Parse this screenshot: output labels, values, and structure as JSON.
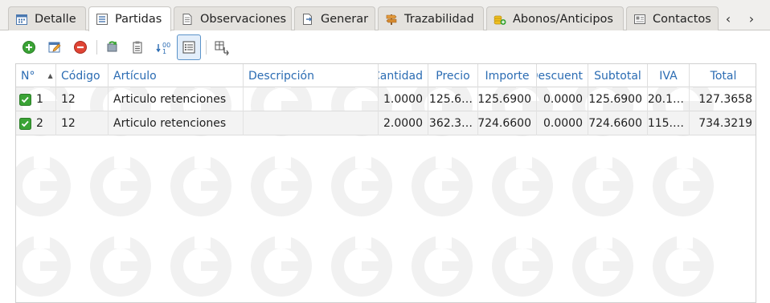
{
  "tabs": [
    {
      "label": "Detalle",
      "icon": "calendar-icon",
      "active": false
    },
    {
      "label": "Partidas",
      "icon": "list-icon",
      "active": true
    },
    {
      "label": "Observaciones",
      "icon": "document-icon",
      "active": false
    },
    {
      "label": "Generar",
      "icon": "document-arrow-icon",
      "active": false
    },
    {
      "label": "Trazabilidad",
      "icon": "signpost-icon",
      "active": false
    },
    {
      "label": "Abonos/Anticipos",
      "icon": "coins-add-icon",
      "active": false
    },
    {
      "label": "Contactos",
      "icon": "contacts-card-icon",
      "active": false
    }
  ],
  "nav": {
    "prev": "‹",
    "next": "›"
  },
  "toolbar": {
    "buttons": [
      "add-icon",
      "edit-icon",
      "remove-icon",
      "refresh-icon",
      "clipboard-icon",
      "numbering-icon",
      "list-settings-icon",
      "columns-icon"
    ]
  },
  "grid": {
    "columns": [
      {
        "label": "N°",
        "sort": "ascending"
      },
      {
        "label": "Código"
      },
      {
        "label": "Artículo"
      },
      {
        "label": "Descripción"
      },
      {
        "label": "Cantidad"
      },
      {
        "label": "Precio"
      },
      {
        "label": "Importe"
      },
      {
        "label": "Descuent"
      },
      {
        "label": "Subtotal"
      },
      {
        "label": "IVA"
      },
      {
        "label": "Total"
      }
    ],
    "sort_arrow": "▲",
    "rows": [
      {
        "checked": true,
        "n": "1",
        "codigo": "12",
        "articulo": "Articulo retenciones",
        "descripcion": "",
        "cantidad": "1.0000",
        "precio": "125.6…",
        "importe": "125.6900",
        "descuento": "0.0000",
        "subtotal": "125.6900",
        "iva": "20.1…",
        "total": "127.3658"
      },
      {
        "checked": true,
        "n": "2",
        "codigo": "12",
        "articulo": "Articulo retenciones",
        "descripcion": "",
        "cantidad": "2.0000",
        "precio": "362.3…",
        "importe": "724.6600",
        "descuento": "0.0000",
        "subtotal": "724.6600",
        "iva": "115.…",
        "total": "734.3219"
      }
    ]
  },
  "colors": {
    "header_text": "#2b6cb3",
    "check_green": "#3aa335",
    "alt_row": "#f3f3f3"
  }
}
